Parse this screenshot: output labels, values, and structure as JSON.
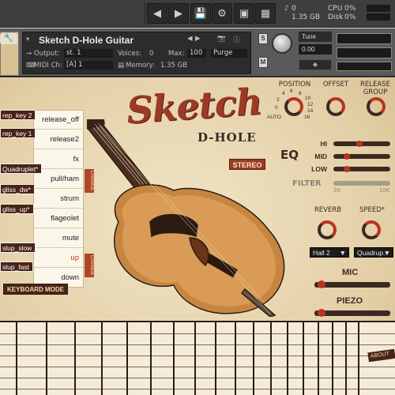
{
  "topbar": {
    "buttons": [
      "◀",
      "▶",
      "💾",
      "⚙",
      "▣",
      "▦",
      "◐"
    ],
    "cpu_label": "CPU",
    "cpu_value": "0%",
    "disk_label": "Disk",
    "disk_value": "0%",
    "voices": "0",
    "memory": "1.35 GB"
  },
  "header": {
    "instrument_name": "Sketch D-Hole Guitar",
    "output_label": "Output:",
    "output_value": "st. 1",
    "voices_label": "Voices:",
    "voices_value": "0",
    "max_label": "Max:",
    "max_value": "100",
    "purge_label": "Purge",
    "midi_label": "MIDI Ch:",
    "midi_value": "[A]  1",
    "memory_label": "Memory:",
    "memory_value": "1.35 GB",
    "tune_label": "Tune",
    "tune_value": "0.00",
    "s_button": "S",
    "m_button": "M"
  },
  "articulations": [
    "release_off",
    "release2",
    "fx",
    "pull/ham",
    "strum",
    "flageolet",
    "mute",
    "up",
    "down"
  ],
  "active_articulation": "up",
  "keyswitch_tags": [
    "rep_key 2",
    "rep_key 1",
    "Quadruplet*",
    "gliss_dw*",
    "gliss_up*",
    "slup_slow",
    "slup_fast"
  ],
  "mini_tags": [
    "CHANGE",
    "CHANGE"
  ],
  "keyboard_mode": "KEYBOARD MODE",
  "logo": {
    "main": "Sketch",
    "sub": "D-HOLE"
  },
  "stereo": "STEREO",
  "controls": {
    "position": "POSITION",
    "offset": "OFFSET",
    "release_group": "RELEASE GROUP",
    "position_scale": [
      "4",
      "6",
      "8",
      "10",
      "2",
      "12",
      "0",
      "14",
      "AUTO",
      "16"
    ],
    "eq": "EQ",
    "eq_hi": "HI",
    "eq_mid": "MID",
    "eq_low": "LOW",
    "filter": "FILTER",
    "filter_min": "30",
    "filter_max": "10K",
    "reverb": "REVERB",
    "speed": "SPEED*",
    "reverb_select": "Hall 2",
    "speed_select": "Quadrup.",
    "mic": "MIC",
    "piezo": "PIEZO"
  },
  "levels": {
    "eq_hi": 0.45,
    "eq_mid": 0.2,
    "eq_low": 0.2,
    "mic": 0.05,
    "piezo": 0.05
  },
  "about": "ABOUT",
  "colors": {
    "accent": "#b8351e",
    "dark": "#3a2a22",
    "cream": "#ead9b6"
  }
}
